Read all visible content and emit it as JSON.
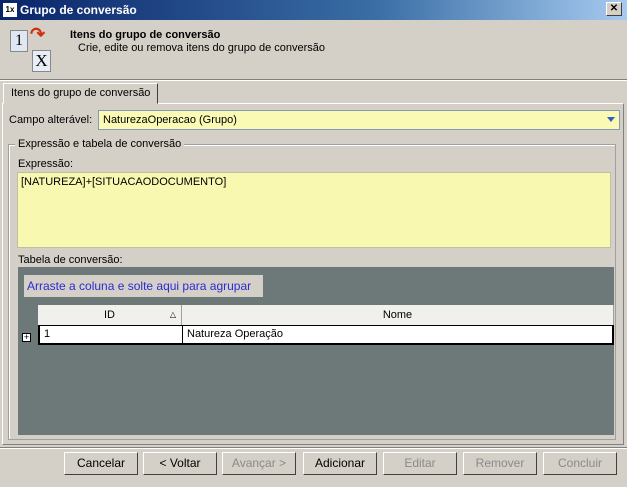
{
  "window": {
    "title": "Grupo de conversão",
    "close": "✕"
  },
  "header": {
    "title": "Itens do grupo de conversão",
    "subtitle": "Crie, edite ou remova itens do grupo de conversão",
    "icon_1": "1",
    "icon_x": "X"
  },
  "tabs": [
    {
      "label": "Itens do grupo de conversão"
    }
  ],
  "campo": {
    "label": "Campo alterável:",
    "value": "NaturezaOperacao (Grupo)"
  },
  "group": {
    "title": "Expressão e tabela de conversão",
    "expr_label": "Expressão:",
    "expr_value": "[NATUREZA]+[SITUACAODOCUMENTO]",
    "table_label": "Tabela de conversão:"
  },
  "grid": {
    "group_hint": "Arraste a coluna e solte aqui para agrupar",
    "columns": [
      "ID",
      "Nome"
    ],
    "rows": [
      [
        "1",
        "Natureza Operação"
      ]
    ]
  },
  "buttons": {
    "cancel": "Cancelar",
    "back": "< Voltar",
    "next": "Avançar >",
    "add": "Adicionar",
    "edit": "Editar",
    "remove": "Remover",
    "finish": "Concluir"
  }
}
